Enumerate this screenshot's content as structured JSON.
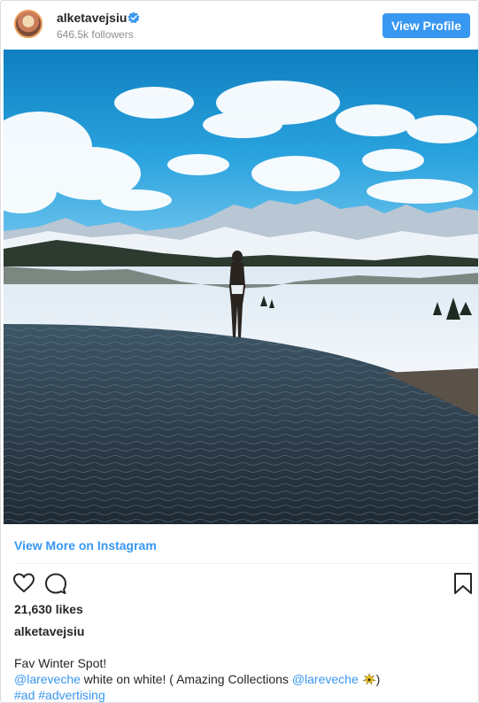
{
  "header": {
    "username": "alketavejsiu",
    "followers": "646.5k followers",
    "view_profile_label": "View Profile",
    "verified_color": "#3897f0"
  },
  "photo": {
    "description_icon": "photo-winter-infinity-pool"
  },
  "view_more_label": "View More on Instagram",
  "actions": {
    "like_icon": "heart-icon",
    "comment_icon": "comment-icon",
    "save_icon": "bookmark-icon"
  },
  "likes": "21,630 likes",
  "caption": {
    "username": "alketavejsiu",
    "line1": "Fav Winter Spot!",
    "mention1": "@lareveche",
    "text1": " white on white! ( Amazing Collections ",
    "mention2": "@lareveche",
    "text2": ")",
    "hashtag1": "#ad",
    "hashtag2": "#advertising"
  },
  "colors": {
    "accent": "#3897f0",
    "text": "#262626",
    "muted": "#8e8e8e"
  }
}
